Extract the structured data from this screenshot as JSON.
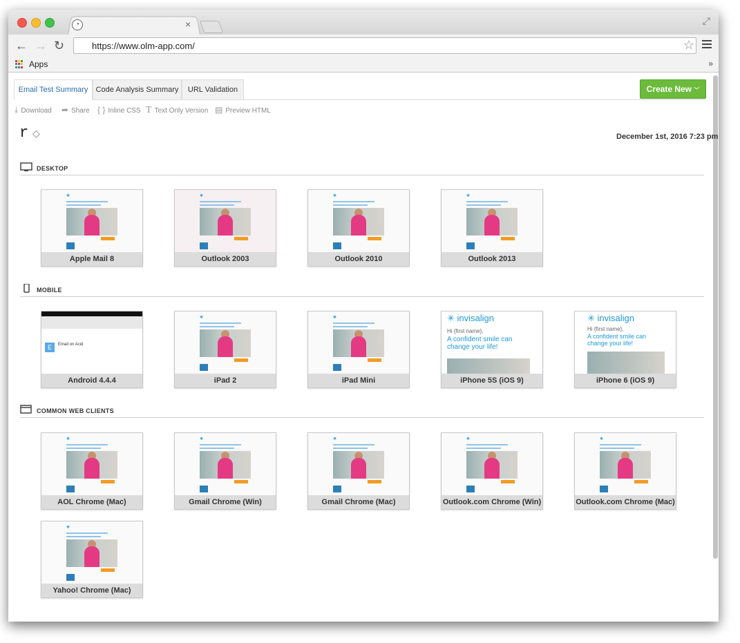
{
  "browser": {
    "url": "https://www.olm-app.com/",
    "bookmarks": {
      "apps_label": "Apps",
      "more": "»"
    }
  },
  "app": {
    "tabs": [
      {
        "label": "Email Test Summary",
        "active": true
      },
      {
        "label": "Code Analysis Summary",
        "active": false
      },
      {
        "label": "URL Validation",
        "active": false
      }
    ],
    "create_button": "Create New",
    "actions": [
      {
        "label": "Download",
        "icon": "download-icon"
      },
      {
        "label": "Share",
        "icon": "share-icon"
      },
      {
        "label": "Inline CSS",
        "icon": "braces-icon"
      },
      {
        "label": "Text Only Version",
        "icon": "text-icon"
      },
      {
        "label": "Preview HTML",
        "icon": "preview-icon"
      }
    ],
    "test_title": "r",
    "date": "December 1st, 2016 7:23 pm",
    "accent_color": "#6cbb3c",
    "link_color": "#2a6db3"
  },
  "sections": {
    "desktop": {
      "title": "DESKTOP",
      "items": [
        "Apple Mail 8",
        "Outlook 2003",
        "Outlook 2010",
        "Outlook 2013"
      ]
    },
    "mobile": {
      "title": "MOBILE",
      "items": [
        "Android 4.4.4",
        "iPad 2",
        "iPad Mini",
        "iPhone 5S (iOS 9)",
        "iPhone 6 (iOS 9)"
      ],
      "preview_texts": {
        "android_sender": "Email on Acid",
        "brand": "invisalign",
        "greeting": "Hi {first name},",
        "headline": "A confident smile can change your life!"
      }
    },
    "web": {
      "title": "COMMON WEB CLIENTS",
      "items": [
        "AOL Chrome (Mac)",
        "Gmail Chrome (Win)",
        "Gmail Chrome (Mac)",
        "Outlook.com Chrome (Win)",
        "Outlook.com Chrome (Mac)",
        "Yahoo! Chrome (Mac)"
      ]
    }
  }
}
